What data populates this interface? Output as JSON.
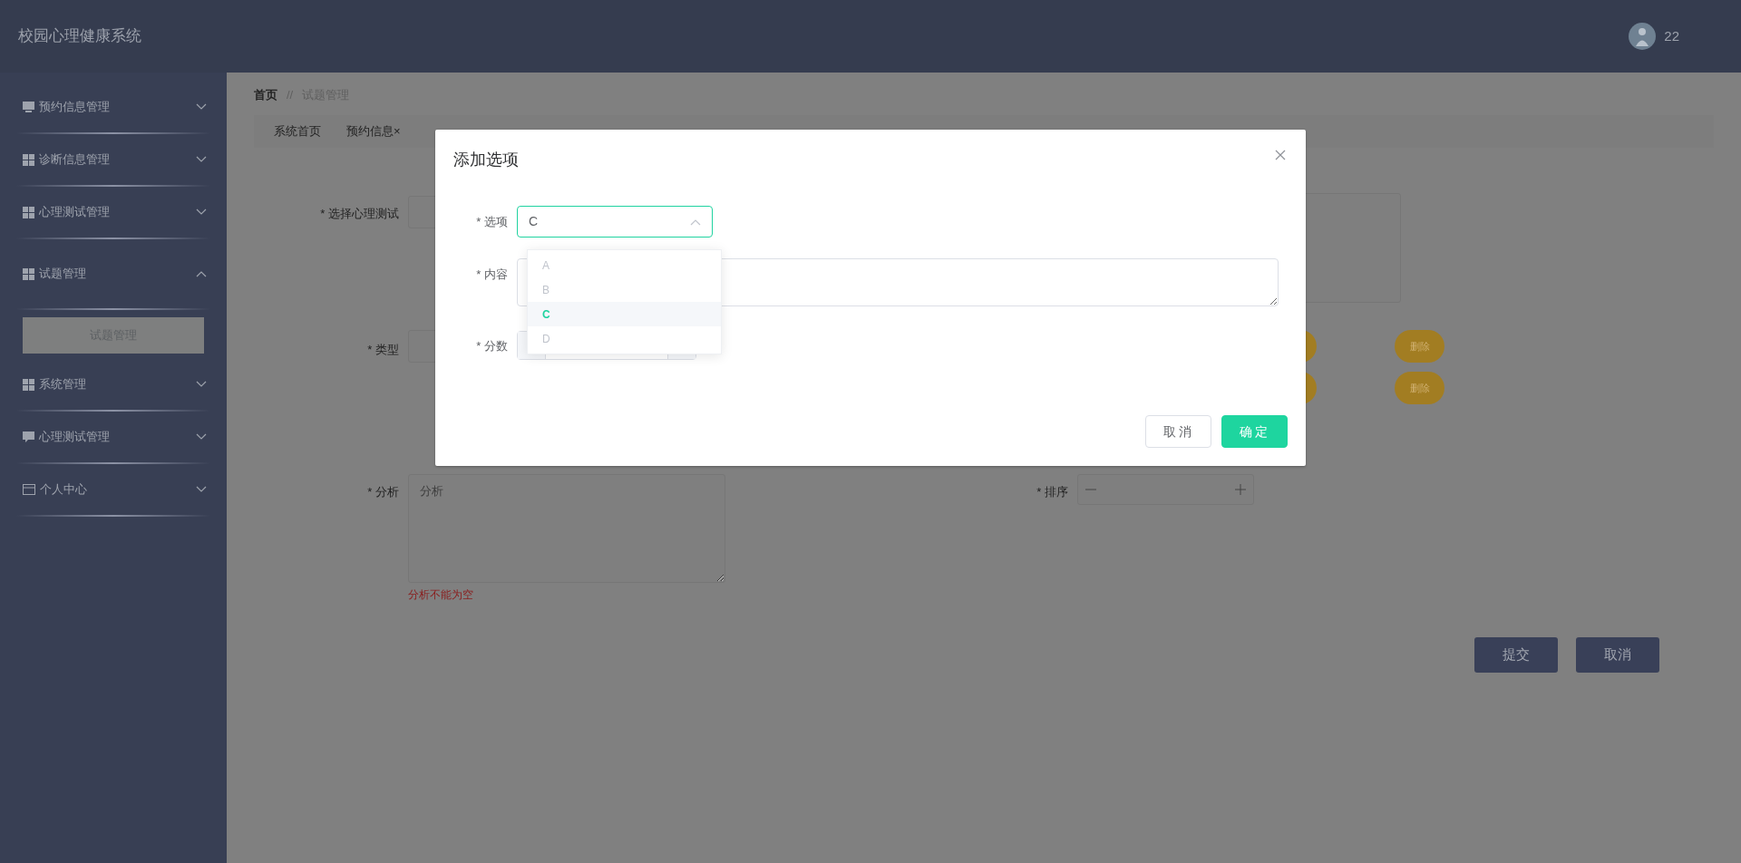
{
  "app": {
    "title": "校园心理健康系统"
  },
  "user": {
    "name": "22"
  },
  "sidebar": {
    "items": [
      {
        "label": "预约信息管理",
        "kind": "monitor",
        "expanded": false
      },
      {
        "label": "诊断信息管理",
        "kind": "grid",
        "expanded": false
      },
      {
        "label": "心理测试管理",
        "kind": "grid",
        "expanded": false
      },
      {
        "label": "试题管理",
        "kind": "grid",
        "expanded": true,
        "children": [
          {
            "label": "试题管理",
            "selected": true
          }
        ]
      },
      {
        "label": "系统管理",
        "kind": "grid",
        "expanded": false
      },
      {
        "label": "心理测试管理",
        "kind": "chat",
        "expanded": false
      },
      {
        "label": "个人中心",
        "kind": "card",
        "expanded": false
      }
    ]
  },
  "breadcrumb": {
    "items": [
      "首页",
      "试题管理"
    ],
    "separator": "//"
  },
  "tabs": [
    {
      "label": "系统首页"
    },
    {
      "label": "预约信息",
      "close": "×"
    }
  ],
  "form": {
    "fields": [
      {
        "label": "选择心理测试",
        "mark": "*",
        "kind": "select"
      },
      {
        "label": "类型",
        "mark": "*",
        "kind": "select"
      },
      {
        "label": "分析",
        "mark": "*",
        "kind": "textarea",
        "placeholder": "分析",
        "error": "分析不能为空"
      },
      {
        "label": "排序",
        "mark": "*",
        "kind": "number"
      }
    ],
    "option_rows": [
      {
        "delete": "删除"
      },
      {
        "delete": "删除"
      }
    ],
    "buttons": [
      "提交",
      "取消"
    ]
  },
  "dialog": {
    "title": "添加选项",
    "fields": [
      {
        "label": "选项",
        "mark": "*",
        "kind": "select",
        "value": "C",
        "expanded": true,
        "options": [
          {
            "label": "A",
            "selected": false
          },
          {
            "label": "B",
            "selected": false
          },
          {
            "label": "C",
            "selected": true
          },
          {
            "label": "D",
            "selected": false
          }
        ]
      },
      {
        "label": "内容",
        "mark": "*",
        "kind": "textarea"
      },
      {
        "label": "分数",
        "mark": "*",
        "kind": "number"
      }
    ],
    "buttons": [
      {
        "label": "取消",
        "kind": "default"
      },
      {
        "label": "确定",
        "kind": "primary"
      }
    ]
  }
}
